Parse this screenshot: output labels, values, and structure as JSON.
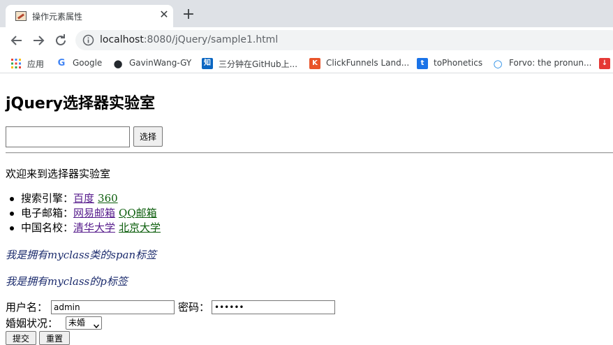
{
  "browser": {
    "tab": {
      "title": "操作元素属性",
      "close_glyph": "✕"
    },
    "new_tab_glyph": "+",
    "address": {
      "host": "localhost",
      "path": ":8080/jQuery/sample1.html"
    },
    "bookmarks": [
      {
        "label": "应用",
        "icon": "apps-grid-icon",
        "color": "#ea4335"
      },
      {
        "label": "Google",
        "icon": "google-icon",
        "glyph": "G",
        "color": "#4285f4"
      },
      {
        "label": "GavinWang-GY",
        "icon": "github-icon",
        "glyph": "●",
        "color": "#24292e"
      },
      {
        "label": "三分钟在GitHub上...",
        "icon": "zhihu-icon",
        "glyph": "知",
        "color": "#0a66c2"
      },
      {
        "label": "ClickFunnels Land...",
        "icon": "clickfunnels-icon",
        "glyph": "K",
        "color": "#e9542a"
      },
      {
        "label": "toPhonetics",
        "icon": "tophonetics-icon",
        "glyph": "t",
        "color": "#1a73e8"
      },
      {
        "label": "Forvo: the pronun...",
        "icon": "forvo-icon",
        "glyph": "○",
        "color": "#1e88e5"
      },
      {
        "label": "",
        "icon": "download-icon",
        "glyph": "↓",
        "color": "#e53935"
      }
    ]
  },
  "page": {
    "heading": "jQuery选择器实验室",
    "selector_input_value": "",
    "select_button": "选择",
    "welcome": "欢迎来到选择器实验室",
    "list": [
      {
        "label": "搜索引擎：",
        "links": [
          {
            "text": "百度",
            "visited": true
          },
          {
            "text": "360",
            "visited": false
          }
        ]
      },
      {
        "label": "电子邮箱：",
        "links": [
          {
            "text": "网易邮箱",
            "visited": true
          },
          {
            "text": "QQ邮箱",
            "visited": false
          }
        ]
      },
      {
        "label": "中国名校：",
        "links": [
          {
            "text": "清华大学",
            "visited": true
          },
          {
            "text": "北京大学",
            "visited": false
          }
        ]
      }
    ],
    "span_text": "我是拥有myclass类的span标签",
    "p_text": "我是拥有myclass的p标签",
    "form": {
      "username_label": "用户名：",
      "username_value": "admin",
      "password_label": "密码：",
      "password_value": "••••••",
      "marital_label": "婚姻状况：",
      "marital_selected": "未婚",
      "submit": "提交",
      "reset": "重置"
    }
  },
  "colors": {
    "visited_link": "#551a8b",
    "unvisited_link": "#0b5d0b",
    "italic_text": "#1a2a6c"
  }
}
